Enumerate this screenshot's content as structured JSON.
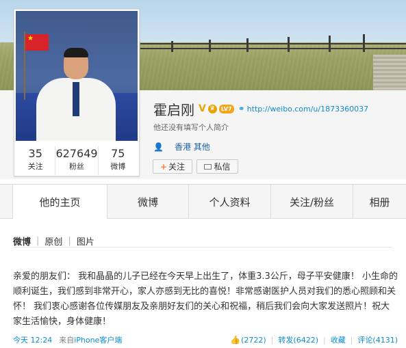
{
  "profile": {
    "name": "霍启刚",
    "verified_mark": "V",
    "level_badge": "LV7",
    "url": "http://weibo.com/u/1873360037",
    "bio": "他还没有填写个人简介",
    "location": "香港 其他"
  },
  "stats": [
    {
      "value": "35",
      "label": "关注"
    },
    {
      "value": "627649",
      "label": "粉丝"
    },
    {
      "value": "75",
      "label": "微博"
    }
  ],
  "actions": {
    "follow_label": "关注",
    "message_label": "私信"
  },
  "tabs": [
    {
      "label": "他的主页",
      "active": true
    },
    {
      "label": "微博",
      "active": false
    },
    {
      "label": "个人资料",
      "active": false
    },
    {
      "label": "关注/粉丝",
      "active": false
    },
    {
      "label": "相册",
      "active": false
    }
  ],
  "feed_filter": [
    "微博",
    "原创",
    "图片"
  ],
  "post": {
    "text": "亲爱的朋友们： 我和晶晶的儿子已经在今天早上出生了，体重3.3公斤，母子平安健康！ 小生命的顺利诞生，我们感到非常开心，家人亦感到无比的喜悦！非常感谢医护人员对我们的悉心照顾和关怀！ 我们衷心感谢各位传媒朋友及亲朋好友们的关心和祝福，稍后我们会向大家发送照片！祝大家生活愉快，身体健康！",
    "time": "今天 12:24",
    "source_prefix": "来自",
    "source": "iPhone客户端",
    "likes": "(2722)",
    "repost": "转发(6422)",
    "favorite": "收藏",
    "comment": "评论(4131)"
  },
  "colors": {
    "link": "#0a8cd2",
    "follow_plus": "#ff8140",
    "badge_gold": "#e8a400"
  }
}
